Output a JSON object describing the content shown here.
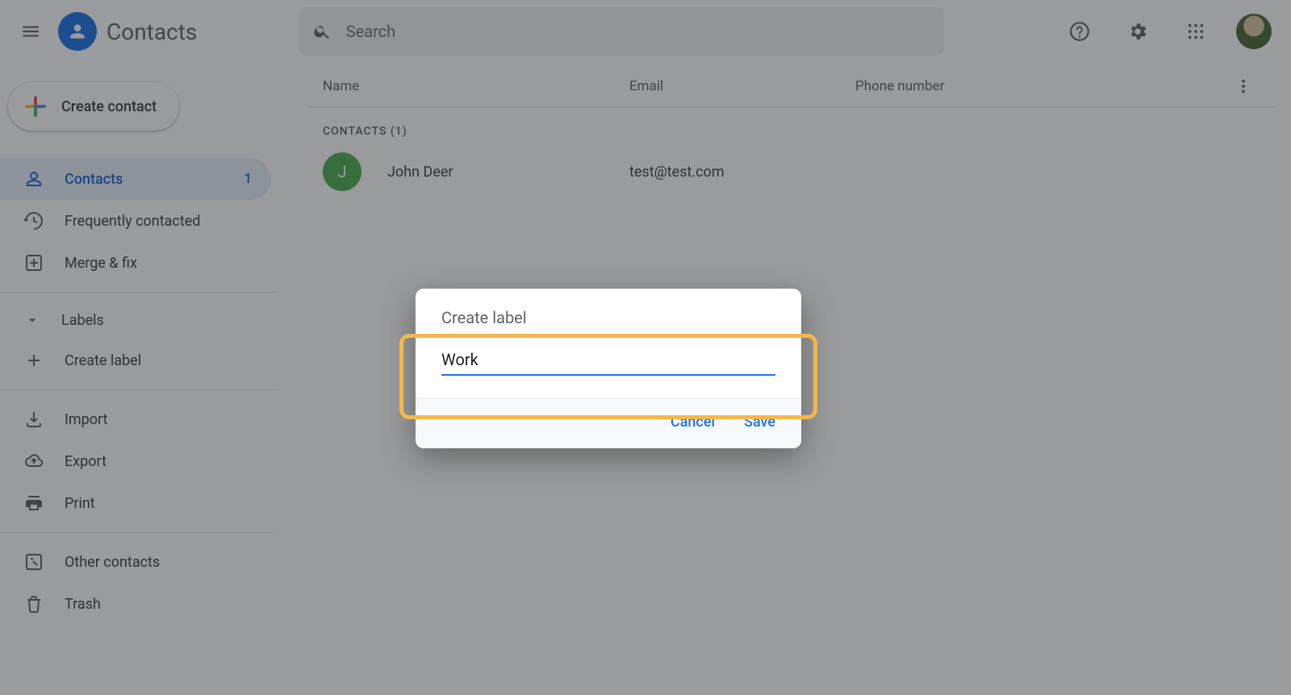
{
  "app": {
    "name": "Contacts"
  },
  "search": {
    "placeholder": "Search"
  },
  "create_button": {
    "label": "Create contact"
  },
  "sidebar": {
    "contacts": {
      "label": "Contacts",
      "count": "1"
    },
    "frequent": {
      "label": "Frequently contacted"
    },
    "merge": {
      "label": "Merge & fix"
    },
    "labels_header": "Labels",
    "create_label": "Create label",
    "import": "Import",
    "export": "Export",
    "print": "Print",
    "other": "Other contacts",
    "trash": "Trash"
  },
  "table": {
    "headers": {
      "name": "Name",
      "email": "Email",
      "phone": "Phone number"
    },
    "section": "CONTACTS (1)",
    "rows": [
      {
        "initial": "J",
        "name": "John Deer",
        "email": "test@test.com",
        "phone": ""
      }
    ]
  },
  "dialog": {
    "title": "Create label",
    "value": "Work",
    "cancel": "Cancel",
    "save": "Save"
  }
}
